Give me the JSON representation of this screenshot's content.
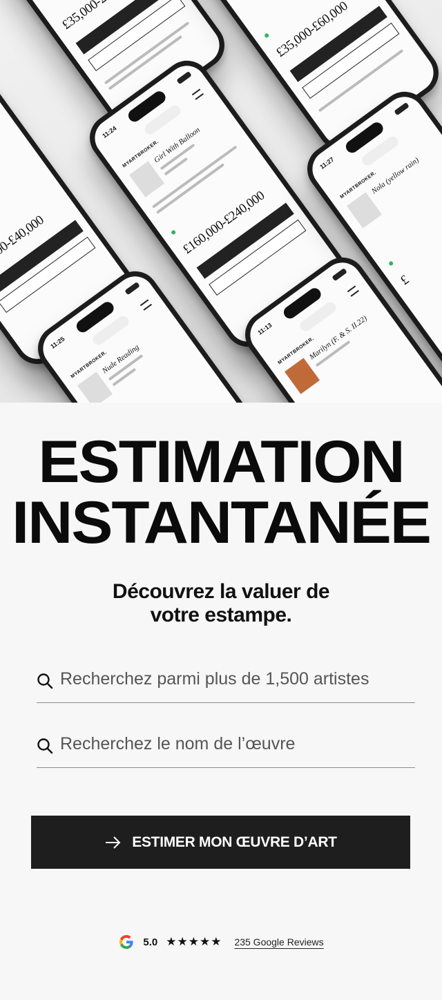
{
  "hero": {
    "image_alt": "Phones showing MyArtBroker artwork valuation screens"
  },
  "headline": {
    "line1": "ESTIMATION",
    "line2": "INSTANTANÉE"
  },
  "subheadline": {
    "line1": "Découvrez la valuer de",
    "line2": "votre estampe."
  },
  "search": {
    "artist_placeholder": "Recherchez parmi plus de 1,500 artistes",
    "artwork_placeholder": "Recherchez le nom de l’œuvre"
  },
  "cta": {
    "label": "ESTIMER MON ŒUVRE D’ART"
  },
  "reviews": {
    "score": "5.0",
    "stars": "★★★★★",
    "link_label": "235 Google Reviews"
  },
  "colors": {
    "background": "#f7f7f7",
    "button": "#1e1e1e",
    "status_green": "#2eb65c"
  }
}
